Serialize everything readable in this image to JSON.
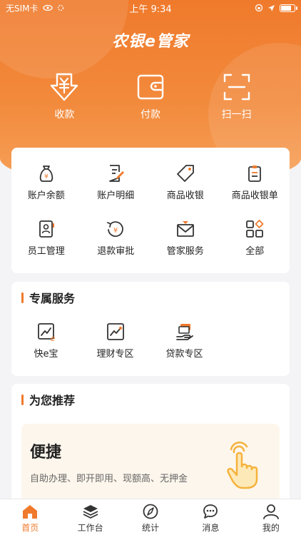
{
  "status_bar": {
    "carrier": "无SIM卡",
    "time": "上午 9:34"
  },
  "brand": {
    "logo_text": "农银e管家"
  },
  "quick_actions": [
    {
      "label": "收款",
      "icon": "yuan-download-icon"
    },
    {
      "label": "付款",
      "icon": "wallet-icon"
    },
    {
      "label": "扫一扫",
      "icon": "scan-icon"
    }
  ],
  "services": [
    {
      "label": "账户余额",
      "icon": "money-bag-icon"
    },
    {
      "label": "账户明细",
      "icon": "document-edit-icon"
    },
    {
      "label": "商品收银",
      "icon": "price-tag-icon"
    },
    {
      "label": "商品收银单",
      "icon": "clipboard-icon"
    },
    {
      "label": "员工管理",
      "icon": "employee-badge-icon"
    },
    {
      "label": "退款审批",
      "icon": "refund-icon"
    },
    {
      "label": "管家服务",
      "icon": "envelope-icon"
    },
    {
      "label": "全部",
      "icon": "grid-all-icon"
    }
  ],
  "exclusive": {
    "title": "专属服务",
    "items": [
      {
        "label": "快e宝",
        "icon": "chart-e-icon"
      },
      {
        "label": "理财专区",
        "icon": "trend-chart-icon"
      },
      {
        "label": "贷款专区",
        "icon": "loan-hand-icon"
      }
    ]
  },
  "recommend": {
    "title": "为您推荐",
    "promo_title": "便捷",
    "promo_desc": "自助办理、即开即用、现额高、无押金"
  },
  "tabs": [
    {
      "label": "首页",
      "icon": "home-icon",
      "active": true
    },
    {
      "label": "工作台",
      "icon": "layers-icon",
      "active": false
    },
    {
      "label": "统计",
      "icon": "compass-icon",
      "active": false
    },
    {
      "label": "消息",
      "icon": "chat-icon",
      "active": false
    },
    {
      "label": "我的",
      "icon": "user-icon",
      "active": false
    }
  ],
  "colors": {
    "accent": "#f07a2c",
    "icon_dark": "#333333"
  }
}
